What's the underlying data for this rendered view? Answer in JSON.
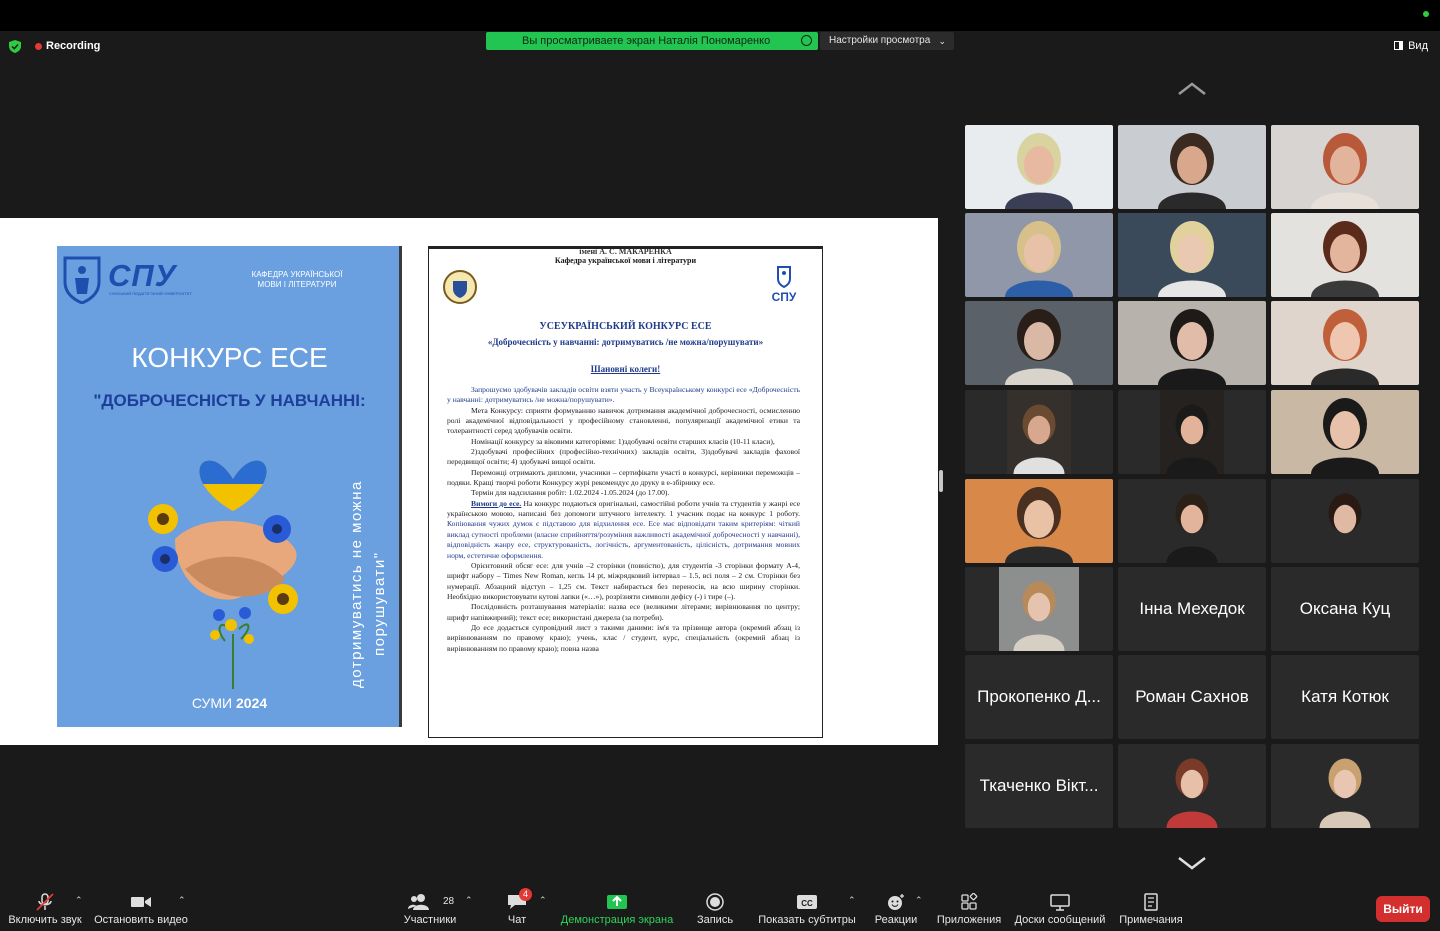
{
  "status": {
    "recording_label": "Recording"
  },
  "share_banner": {
    "text": "Вы просматриваете экран Наталія Пономаренко",
    "view_settings": "Настройки просмотра"
  },
  "view_button": "Вид",
  "poster": {
    "brand": "СПУ",
    "brand_sub": "СУМСЬКИЙ ПЕДАГОГІЧНИЙ УНІВЕРСИТЕТ",
    "department": "КАФЕДРА УКРАЇНСЬКОЇ МОВИ І ЛІТЕРАТУРИ",
    "title": "КОНКУРС ЕСЕ",
    "subtitle": "\"ДОБРОЧЕСНІСТЬ У НАВЧАННІ:",
    "vertical_line1": "дотримуватись не можна",
    "vertical_line2": "порушувати\"",
    "city": "СУМИ",
    "year": "2024"
  },
  "document": {
    "cut_line": "імені А. С. МАКАРЕНКА",
    "department": "Кафедра української мови і літератури",
    "heading": "УСЕУКРАЇНСЬКИЙ КОНКУРС ЕСЕ",
    "subheading": "«Доброчесність у навчанні: дотримуватись /не можна/порушувати»",
    "greeting": "Шановні колеги!",
    "p1": "Запрошуємо здобувачів закладів освіти взяти участь у Всеукраїнському конкурсі есе «Доброчесність у навчанні: дотримуватись /не можна/порушувати».",
    "p2": "Мета Конкурсу: сприяти формуванню навичок дотримання академічної доброчесності, осмисленню ролі академічної відповідальності у професійному становленні, популяризації академічної етики та толерантності серед здобувачів освіти.",
    "p3": "Номінації конкурсу за віковими категоріями: 1)здобувачі освіти старших класів (10-11 класи),",
    "p4": "2)здобувачі професійних (професійно-технічних) закладів освіти, 3)здобувачі закладів фахової передвищої освіти; 4) здобувачі вищої освіти.",
    "p5": "Переможці отримають дипломи, учасники – сертифікати участі в конкурсі, керівники переможців – подяки. Кращі творчі роботи Конкурсу журі рекомендує до друку в е-збірнику есе.",
    "p6": "Термін для надсилання робіт: 1.02.2024 -1.05.2024 (до 17.00).",
    "req_label": "Вимоги до есе.",
    "p7": " На конкурс подаються оригінальні, самостійні роботи учнів та студентів у жанрі есе українською мовою, написані без допомоги штучного інтелекту. 1 учасник подає на конкурс 1 роботу. ",
    "p7_blue": "Копіювання чужих думок є підставою для відхилення есе. Есе має відповідати таким критеріям: чіткий виклад сутності проблеми (власне сприйняття/розуміння важливості академічної доброчесності у навчанні), відповідність жанру есе, структурованість, логічність, аргументованість, цілісність, дотримання мовних норм, естетичне оформлення.",
    "p8": "Орієнтовний обсяг есе: для учнів –2 сторінки (повністю), для студентів -3 сторінки формату А-4, шрифт набору – Times New Roman, кегль 14 pt, міжрядковий інтервал – 1.5, всі поля – 2 см. Сторінки без нумерації. Абзацний відступ – 1,25 см. Текст набирається без переносів, на всю ширину сторінки. Необхідно використовувати кутові лапки («…»), розрізняти символи дефісу (-) і тире (–).",
    "p9": "Послідовність розташування матеріалів:  назва есе (великими літерами; вирівнювання по центру; шрифт напівжирний); текст есе; використані джерела (за потреби).",
    "p10": "До есе додається супровідний лист з такими даними: ім'я та прізвище автора (окремий абзац із вирівнюванням по правому краю); учень, клас / студент, курс, спеціальність (окремий абзац із вирівнюванням по правому краю);  повна назва"
  },
  "participants": [
    {
      "type": "video"
    },
    {
      "type": "video"
    },
    {
      "type": "video"
    },
    {
      "type": "video"
    },
    {
      "type": "video",
      "active": true
    },
    {
      "type": "video"
    },
    {
      "type": "video"
    },
    {
      "type": "video"
    },
    {
      "type": "video"
    },
    {
      "type": "video"
    },
    {
      "type": "video"
    },
    {
      "type": "video"
    },
    {
      "type": "video"
    },
    {
      "type": "video"
    },
    {
      "type": "video"
    },
    {
      "type": "video"
    },
    {
      "type": "name",
      "name": "Інна Мехедок"
    },
    {
      "type": "name",
      "name": "Оксана Куц"
    },
    {
      "type": "name",
      "name": "Прокопенко Д..."
    },
    {
      "type": "name",
      "name": "Роман Сахнов"
    },
    {
      "type": "name",
      "name": "Катя Котюк"
    },
    {
      "type": "name",
      "name": "Ткаченко Вікт..."
    },
    {
      "type": "video"
    },
    {
      "type": "video"
    }
  ],
  "participant_labels": {
    "n17": "Інна Мехедок",
    "n18": "Оксана Куц",
    "n19": "Прокопенко Д...",
    "n20": "Роман Сахнов",
    "n21": "Катя Котюк",
    "n22": "Ткаченко Вікт..."
  },
  "toolbar": {
    "mute": "Включить звук",
    "video": "Остановить видео",
    "participants": "Участники",
    "participants_count": "28",
    "chat": "Чат",
    "chat_badge": "4",
    "share": "Демонстрация экрана",
    "record": "Запись",
    "captions": "Показать субтитры",
    "captions_icon": "CC",
    "reactions": "Реакции",
    "apps": "Приложения",
    "whiteboard": "Доски сообщений",
    "notes": "Примечания",
    "exit": "Выйти"
  },
  "colors": {
    "share_green": "#23c552",
    "exit_red": "#d32f2f",
    "poster_blue": "#6a9fe0",
    "active_border": "#2ecc40"
  }
}
